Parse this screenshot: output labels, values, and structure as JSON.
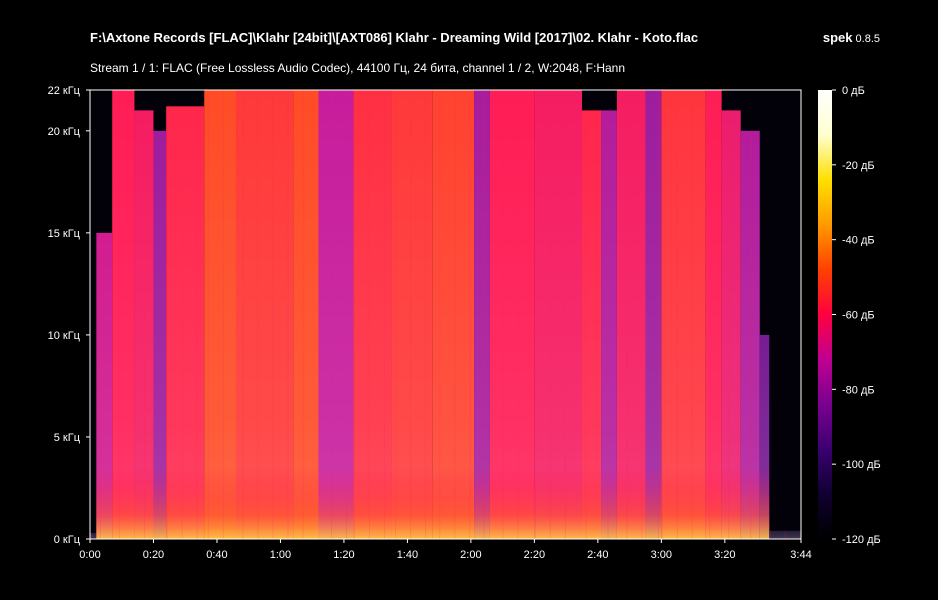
{
  "header": {
    "file_title": "F:\\Axtone Records [FLAC]\\Klahr [24bit]\\[AXT086] Klahr - Dreaming Wild [2017]\\02. Klahr - Koto.flac",
    "app_name": "spek",
    "app_version": "0.8.5",
    "stream_info": "Stream 1 / 1: FLAC (Free Lossless Audio Codec), 44100 Гц, 24 бита, channel 1 / 2, W:2048, F:Hann"
  },
  "chart_data": {
    "type": "heatmap",
    "title": "",
    "xlabel": "",
    "ylabel": "",
    "x_unit": "seconds",
    "x_ticks": [
      {
        "value": 0,
        "label": "0:00"
      },
      {
        "value": 20,
        "label": "0:20"
      },
      {
        "value": 40,
        "label": "0:40"
      },
      {
        "value": 60,
        "label": "1:00"
      },
      {
        "value": 80,
        "label": "1:20"
      },
      {
        "value": 100,
        "label": "1:40"
      },
      {
        "value": 120,
        "label": "2:00"
      },
      {
        "value": 140,
        "label": "2:20"
      },
      {
        "value": 160,
        "label": "2:40"
      },
      {
        "value": 180,
        "label": "3:00"
      },
      {
        "value": 200,
        "label": "3:20"
      },
      {
        "value": 224,
        "label": "3:44"
      }
    ],
    "xlim": [
      0,
      224
    ],
    "y_unit": "kHz",
    "y_ticks": [
      {
        "value": 0,
        "label": "0 кГц"
      },
      {
        "value": 5,
        "label": "5 кГц"
      },
      {
        "value": 10,
        "label": "10 кГц"
      },
      {
        "value": 15,
        "label": "15 кГц"
      },
      {
        "value": 20,
        "label": "20 кГц"
      },
      {
        "value": 22,
        "label": "22 кГц"
      }
    ],
    "ylim": [
      0,
      22
    ],
    "colorbar": {
      "unit": "dB",
      "range": [
        -120,
        0
      ],
      "ticks": [
        {
          "value": 0,
          "label": "0 дБ"
        },
        {
          "value": -20,
          "label": "-20 дБ"
        },
        {
          "value": -40,
          "label": "-40 дБ"
        },
        {
          "value": -60,
          "label": "-60 дБ"
        },
        {
          "value": -80,
          "label": "-80 дБ"
        },
        {
          "value": -100,
          "label": "-100 дБ"
        },
        {
          "value": -120,
          "label": "-120 дБ"
        }
      ],
      "colors": [
        "#000000",
        "#100030",
        "#3a0070",
        "#7a0090",
        "#c00090",
        "#ff0040",
        "#ff4000",
        "#ff9a00",
        "#ffe000",
        "#ffffd0",
        "#ffffff"
      ]
    },
    "segments": [
      {
        "start": 0,
        "end": 2,
        "cutoff": 0.3,
        "level": -110
      },
      {
        "start": 2,
        "end": 7,
        "cutoff": 15,
        "level": -70
      },
      {
        "start": 7,
        "end": 14,
        "cutoff": 22,
        "level": -60
      },
      {
        "start": 14,
        "end": 20,
        "cutoff": 21,
        "level": -62
      },
      {
        "start": 20,
        "end": 24,
        "cutoff": 20,
        "level": -80
      },
      {
        "start": 24,
        "end": 36,
        "cutoff": 21.2,
        "level": -58
      },
      {
        "start": 36,
        "end": 46,
        "cutoff": 22,
        "level": -50
      },
      {
        "start": 46,
        "end": 64,
        "cutoff": 22,
        "level": -54
      },
      {
        "start": 64,
        "end": 72,
        "cutoff": 22,
        "level": -50
      },
      {
        "start": 72,
        "end": 83,
        "cutoff": 22,
        "level": -72
      },
      {
        "start": 83,
        "end": 95,
        "cutoff": 22,
        "level": -56
      },
      {
        "start": 95,
        "end": 108,
        "cutoff": 22,
        "level": -54
      },
      {
        "start": 108,
        "end": 121,
        "cutoff": 22,
        "level": -52
      },
      {
        "start": 121,
        "end": 126,
        "cutoff": 22,
        "level": -78
      },
      {
        "start": 126,
        "end": 140,
        "cutoff": 22,
        "level": -60
      },
      {
        "start": 140,
        "end": 155,
        "cutoff": 22,
        "level": -62
      },
      {
        "start": 155,
        "end": 161,
        "cutoff": 21,
        "level": -58
      },
      {
        "start": 161,
        "end": 166,
        "cutoff": 21,
        "level": -76
      },
      {
        "start": 166,
        "end": 175,
        "cutoff": 22,
        "level": -62
      },
      {
        "start": 175,
        "end": 180,
        "cutoff": 22,
        "level": -80
      },
      {
        "start": 180,
        "end": 194,
        "cutoff": 22,
        "level": -55
      },
      {
        "start": 194,
        "end": 199,
        "cutoff": 22,
        "level": -60
      },
      {
        "start": 199,
        "end": 205,
        "cutoff": 21,
        "level": -64
      },
      {
        "start": 205,
        "end": 211,
        "cutoff": 20,
        "level": -76
      },
      {
        "start": 211,
        "end": 214,
        "cutoff": 10,
        "level": -88
      },
      {
        "start": 214,
        "end": 224,
        "cutoff": 0.4,
        "level": -112
      }
    ]
  }
}
